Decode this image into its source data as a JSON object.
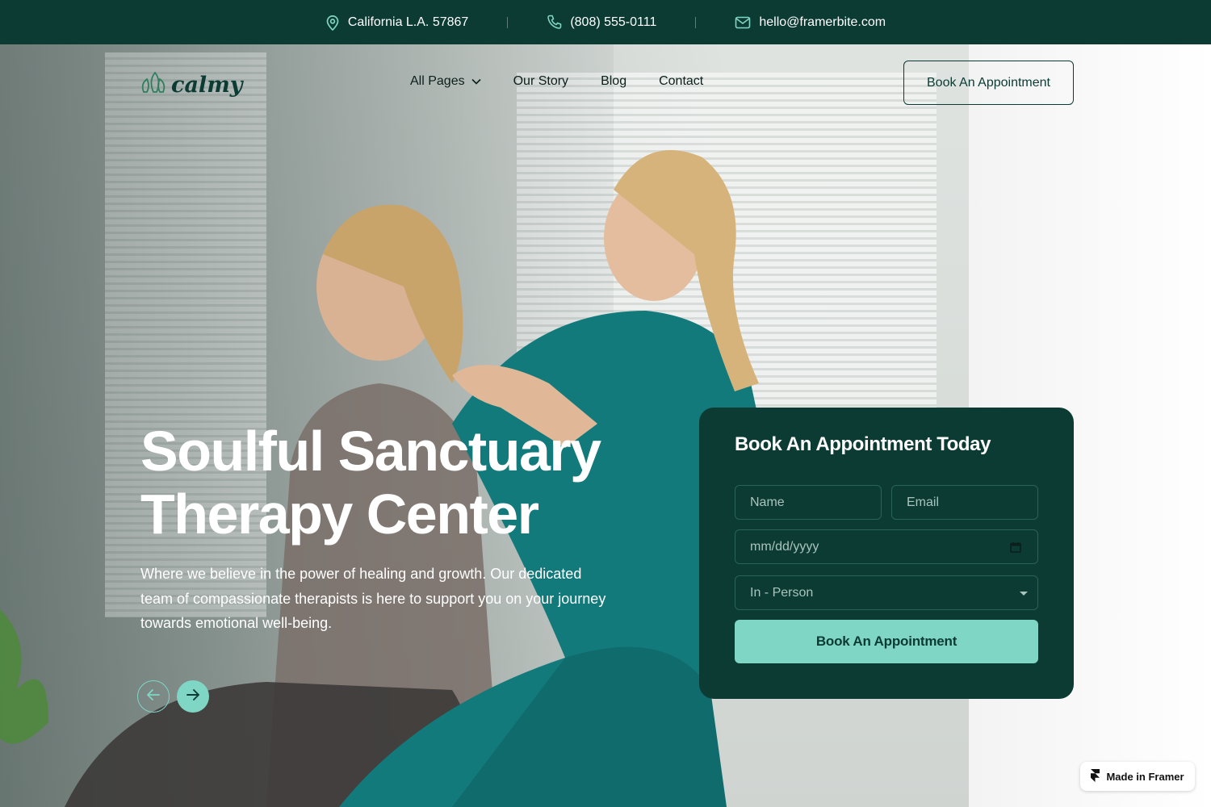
{
  "colors": {
    "brand_dark": "#0b3b33",
    "accent": "#7fd6c5",
    "text_on_dark": "#ffffff"
  },
  "topbar": {
    "address": "California L.A. 57867",
    "phone": "(808) 555-0111",
    "email": "hello@framerbite.com",
    "icons": [
      "location-pin-icon",
      "phone-icon",
      "mail-icon"
    ]
  },
  "nav": {
    "logo_text": "calmy",
    "links": [
      {
        "label": "All Pages",
        "has_dropdown": true
      },
      {
        "label": "Our Story"
      },
      {
        "label": "Blog"
      },
      {
        "label": "Contact"
      }
    ],
    "cta_label": "Book An Appointment"
  },
  "hero": {
    "title_line1": "Soulful Sanctuary",
    "title_line2": "Therapy Center",
    "description": "Where we believe in the power of healing and growth. Our dedicated team of compassionate therapists is here to support you on your journey towards emotional well-being."
  },
  "booking": {
    "title": "Book An Appointment Today",
    "name_placeholder": "Name",
    "email_placeholder": "Email",
    "date_placeholder": "mm/dd/yyyy",
    "session_type": "In - Person",
    "submit_label": "Book An Appointment"
  },
  "badge": {
    "label": "Made in Framer"
  }
}
